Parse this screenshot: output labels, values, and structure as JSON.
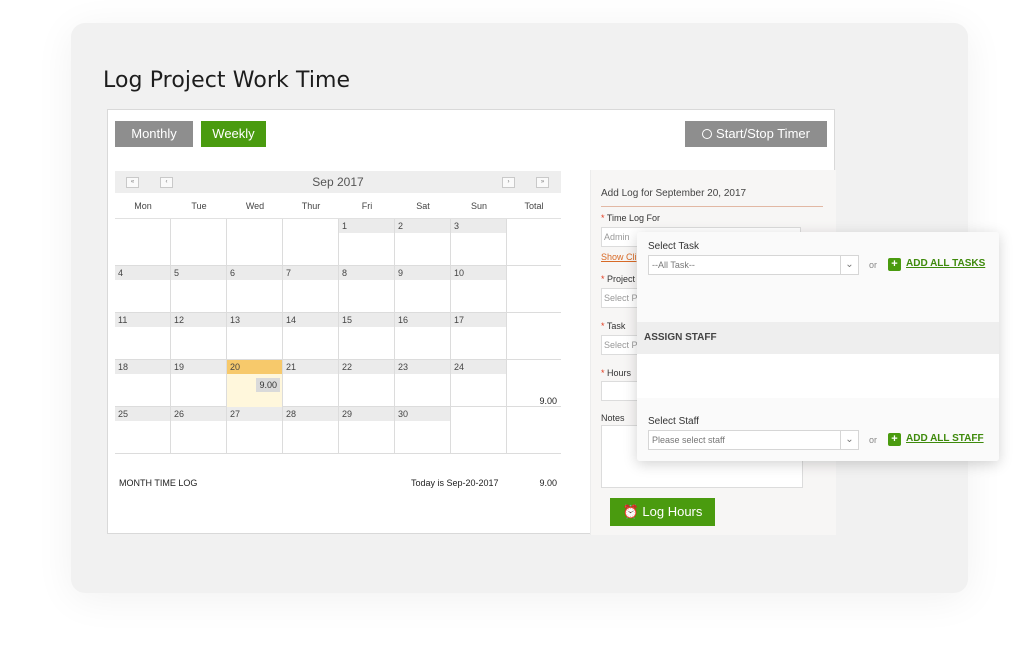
{
  "page_title": "Log Project Work Time",
  "tabs": {
    "monthly": "Monthly",
    "weekly": "Weekly"
  },
  "timer_label": "Start/Stop Timer",
  "calendar": {
    "month_label": "Sep 2017",
    "nav": {
      "prev_year": "«",
      "prev": "‹",
      "next": "›",
      "next_year": "»"
    },
    "weekdays": [
      "Mon",
      "Tue",
      "Wed",
      "Thur",
      "Fri",
      "Sat",
      "Sun",
      "Total"
    ],
    "weeks": [
      {
        "days": [
          "",
          "",
          "",
          "",
          "1",
          "2",
          "3"
        ],
        "total": ""
      },
      {
        "days": [
          "4",
          "5",
          "6",
          "7",
          "8",
          "9",
          "10"
        ],
        "total": ""
      },
      {
        "days": [
          "11",
          "12",
          "13",
          "14",
          "15",
          "16",
          "17"
        ],
        "total": ""
      },
      {
        "days": [
          "18",
          "19",
          "20",
          "21",
          "22",
          "23",
          "24"
        ],
        "total": "9.00"
      },
      {
        "days": [
          "25",
          "26",
          "27",
          "28",
          "29",
          "30",
          ""
        ],
        "total": ""
      }
    ],
    "today_hours": "9.00",
    "footer": {
      "label": "MONTH TIME LOG",
      "today": "Today is Sep-20-2017",
      "total": "9.00"
    }
  },
  "side": {
    "title": "Add Log for September 20, 2017",
    "time_log_for_label": "Time Log For",
    "time_log_for_value": "Admin",
    "show_client_link": "Show Cli",
    "project_label": "Project",
    "project_placeholder": "Select P",
    "task_label": "Task",
    "task_placeholder": "Select P",
    "hours_label": "Hours",
    "notes_label": "Notes",
    "log_button": "Log Hours"
  },
  "popup": {
    "select_task_label": "Select Task",
    "select_task_value": "--All Task--",
    "or_text": "or",
    "add_all_tasks": "ADD ALL TASKS",
    "assign_staff": "ASSIGN STAFF",
    "select_staff_label": "Select Staff",
    "select_staff_placeholder": "Please select staff",
    "add_all_staff": "ADD ALL STAFF"
  },
  "colors": {
    "accent_green": "#4a9b0f",
    "gray_button": "#8e8e8e",
    "today_highlight": "#f7c96b",
    "required": "#e23b1f"
  }
}
